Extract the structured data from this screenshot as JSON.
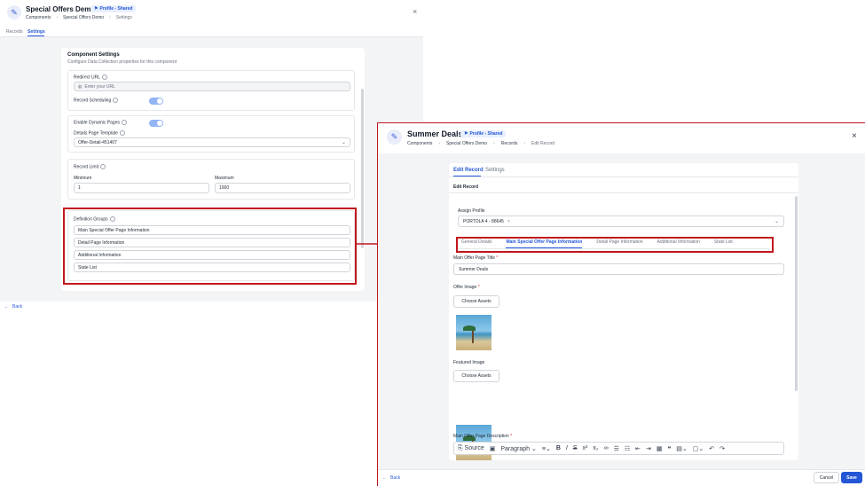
{
  "left": {
    "title": "Special Offers Demo",
    "badge": "Profile - Shared",
    "breadcrumb": [
      "Components",
      "Special Offers Demo",
      "Settings"
    ],
    "tabs": [
      "Records",
      "Settings"
    ],
    "component_settings": {
      "title": "Component Settings",
      "subtitle": "Configure Data Collection properties for this component"
    },
    "redirect_url": {
      "label": "Redirect URL",
      "placeholder": "Enter your URL"
    },
    "record_scheduling": {
      "label": "Record Scheduling"
    },
    "enable_dynamic_pages": {
      "label": "Enable Dynamic Pages"
    },
    "details_page_template": {
      "label": "Details Page Template",
      "value": "Offer-Detail-451407"
    },
    "record_limit": {
      "label": "Record Limit",
      "min_label": "Minimum",
      "min_value": "1",
      "max_label": "Maximum",
      "max_value": "1000"
    },
    "definition_groups": {
      "label": "Definition Groups",
      "items": [
        "Main Special Offer Page Information",
        "Detail Page Information",
        "Additional Information",
        "State List"
      ]
    },
    "back": "Back"
  },
  "right": {
    "title": "Summer Deals",
    "badge": "Profile - Shared",
    "breadcrumb": [
      "Components",
      "Special Offers Demo",
      "Records",
      "Edit Record"
    ],
    "tabs": [
      "Edit Record",
      "Settings"
    ],
    "section_title": "Edit Record",
    "assign_profile": {
      "label": "Assign Profile",
      "chip": "PORTOLA 4 - 88645"
    },
    "group_tabs": [
      "General Details",
      "Main Special Offer Page Information",
      "Detail Page Information",
      "Additional Information",
      "State List"
    ],
    "main_title": {
      "label": "Main Offer Page Title",
      "value": "Summer Deals"
    },
    "offer_image": {
      "label": "Offer Image",
      "button": "Choose Assets"
    },
    "featured_image": {
      "label": "Featured Image",
      "button": "Choose Assets"
    },
    "description": {
      "label": "Main Offer Page Description"
    },
    "toolbar": {
      "source": "Source",
      "paragraph": "Paragraph"
    },
    "back": "Back",
    "cancel": "Cancel",
    "save": "Save"
  },
  "colors": {
    "accent": "#2457d6",
    "highlight": "#c2161e"
  }
}
